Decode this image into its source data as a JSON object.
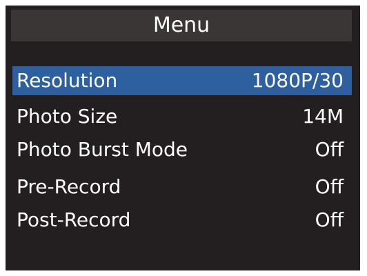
{
  "menu": {
    "title": "Menu",
    "items": [
      {
        "label": "Resolution",
        "value": "1080P/30",
        "selected": true
      },
      {
        "label": "Photo Size",
        "value": "14M",
        "selected": false
      },
      {
        "label": "Photo Burst Mode",
        "value": "Off",
        "selected": false
      },
      {
        "label": "Pre-Record",
        "value": "Off",
        "selected": false
      },
      {
        "label": "Post-Record",
        "value": "Off",
        "selected": false
      }
    ]
  },
  "colors": {
    "background": "#231f20",
    "title_bar": "#3a3636",
    "selected_row": "#2e5f9e",
    "text": "#ffffff"
  }
}
